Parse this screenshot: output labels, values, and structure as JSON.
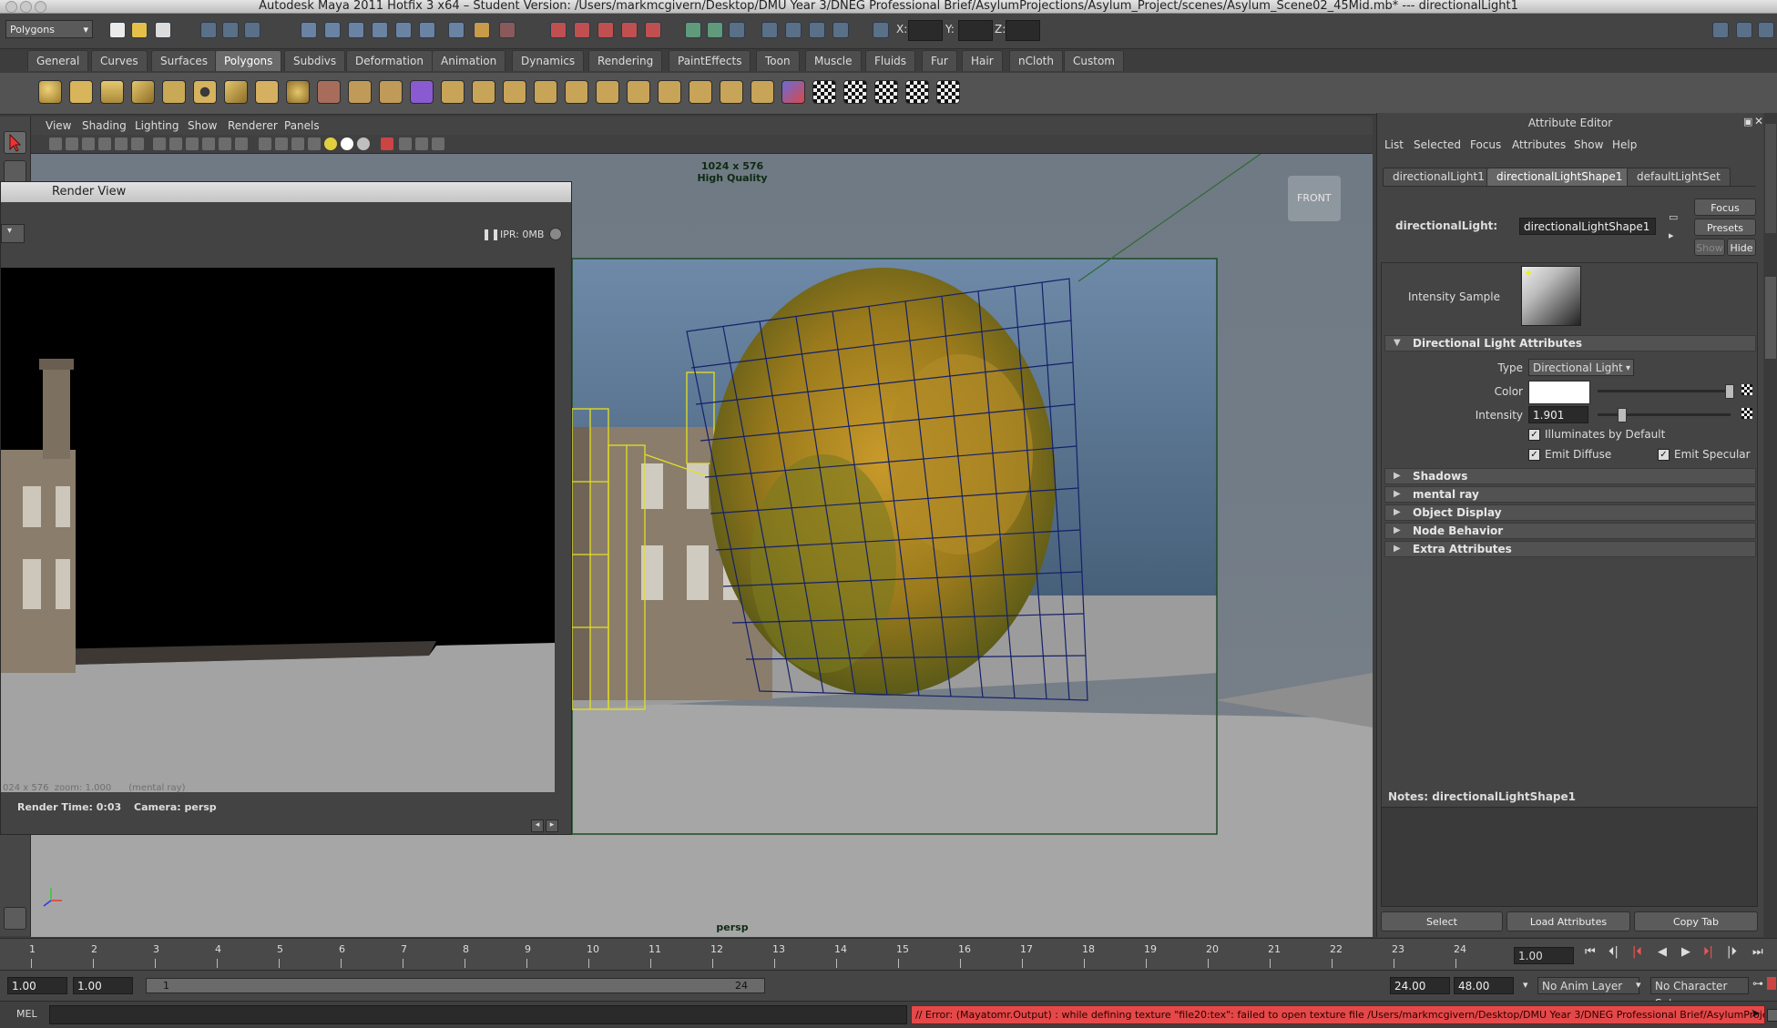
{
  "window": {
    "title": "Autodesk Maya 2011 Hotfix 3 x64 – Student Version: /Users/markmcgivern/Desktop/DMU Year 3/DNEG Professional Brief/AsylumProjections/Asylum_Project/scenes/Asylum_Scene02_45Mid.mb*  ---  directionalLight1"
  },
  "statusline": {
    "mode": "Polygons",
    "x_label": "X:",
    "y_label": "Y:",
    "z_label": "Z:"
  },
  "shelf": {
    "tabs": [
      "General",
      "Curves",
      "Surfaces",
      "Polygons",
      "Subdivs",
      "Deformation",
      "Animation",
      "Dynamics",
      "Rendering",
      "PaintEffects",
      "Toon",
      "Muscle",
      "Fluids",
      "Fur",
      "Hair",
      "nCloth",
      "Custom"
    ],
    "active_tab": "Polygons"
  },
  "panel_menu": [
    "View",
    "Shading",
    "Lighting",
    "Show",
    "Renderer",
    "Panels"
  ],
  "viewport": {
    "resolution": "1024 x 576",
    "quality": "High Quality",
    "camera_label": "persp",
    "viewcube_label": "FRONT"
  },
  "render_view": {
    "title": "Render View",
    "ipr": "IPR: 0MB",
    "image_caption": "024 x 576  zoom: 1.000      (mental ray)",
    "render_time": "Render Time: 0:03",
    "camera": "Camera: persp"
  },
  "attribute_editor": {
    "title": "Attribute Editor",
    "menu": [
      "List",
      "Selected",
      "Focus",
      "Attributes",
      "Show",
      "Help"
    ],
    "tabs": [
      "directionalLight1",
      "directionalLightShape1",
      "defaultLightSet"
    ],
    "active_tab": "directionalLightShape1",
    "node_label": "directionalLight:",
    "node_value": "directionalLightShape1",
    "buttons": {
      "focus": "Focus",
      "presets": "Presets",
      "show": "Show",
      "hide": "Hide"
    },
    "intensity_sample_label": "Intensity Sample",
    "section_open": "Directional Light Attributes",
    "type_label": "Type",
    "type_value": "Directional Light",
    "color_label": "Color",
    "color_value": "#ffffff",
    "intensity_label": "Intensity",
    "intensity_value": "1.901",
    "illuminates_label": "Illuminates by Default",
    "emit_diffuse_label": "Emit Diffuse",
    "emit_specular_label": "Emit Specular",
    "sections_closed": [
      "Shadows",
      "mental ray",
      "Object Display",
      "Node Behavior",
      "Extra Attributes"
    ],
    "notes_label": "Notes:  directionalLightShape1",
    "bottom_buttons": [
      "Select",
      "Load Attributes",
      "Copy Tab"
    ]
  },
  "timeline": {
    "ticks": [
      "1",
      "2",
      "3",
      "4",
      "5",
      "6",
      "7",
      "8",
      "9",
      "10",
      "11",
      "12",
      "13",
      "14",
      "15",
      "16",
      "17",
      "18",
      "19",
      "20",
      "21",
      "22",
      "23",
      "24"
    ],
    "current_frame": "1.00"
  },
  "range": {
    "start": "1.00",
    "playback_start": "1.00",
    "slider_start": "1",
    "slider_end": "24",
    "playback_end": "24.00",
    "end": "48.00",
    "anim_layer": "No Anim Layer",
    "character_set": "No Character Set"
  },
  "command_line": {
    "language": "MEL",
    "error": "// Error: (Mayatomr.Output) : while defining texture \"file20:tex\": failed to open texture file /Users/markmcgivern/Desktop/DMU Year 3/DNEG Professional Brief/AsylumProje"
  }
}
